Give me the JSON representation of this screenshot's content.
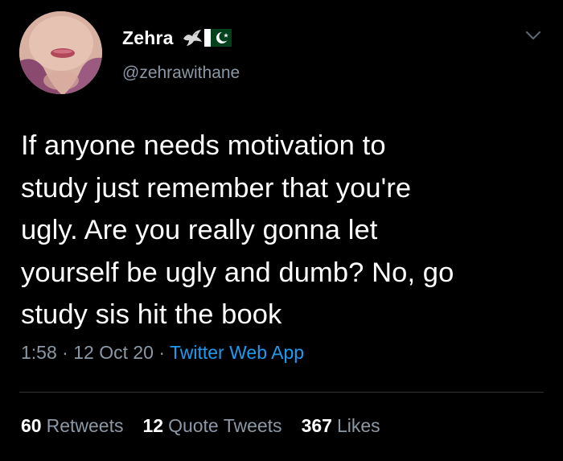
{
  "user": {
    "display_name": "Zehra",
    "handle": "@zehrawithane",
    "emoji_icons": [
      "dove-icon",
      "pakistan-flag-icon"
    ]
  },
  "tweet": {
    "text": "If anyone needs motivation to\nstudy just remember that you're\nugly. Are you really gonna let\nyourself be ugly and dumb? No, go\nstudy sis hit the book"
  },
  "meta": {
    "time": "1:58",
    "separator": " · ",
    "date": "12 Oct 20",
    "source": "Twitter Web App"
  },
  "stats": {
    "retweets_count": "60",
    "retweets_label": "Retweets",
    "quotes_count": "12",
    "quotes_label": "Quote Tweets",
    "likes_count": "367",
    "likes_label": "Likes"
  },
  "colors": {
    "background": "#000000",
    "text": "#ffffff",
    "secondary": "#8b98a5",
    "link": "#1d9bf0",
    "divider": "#2f3336"
  }
}
